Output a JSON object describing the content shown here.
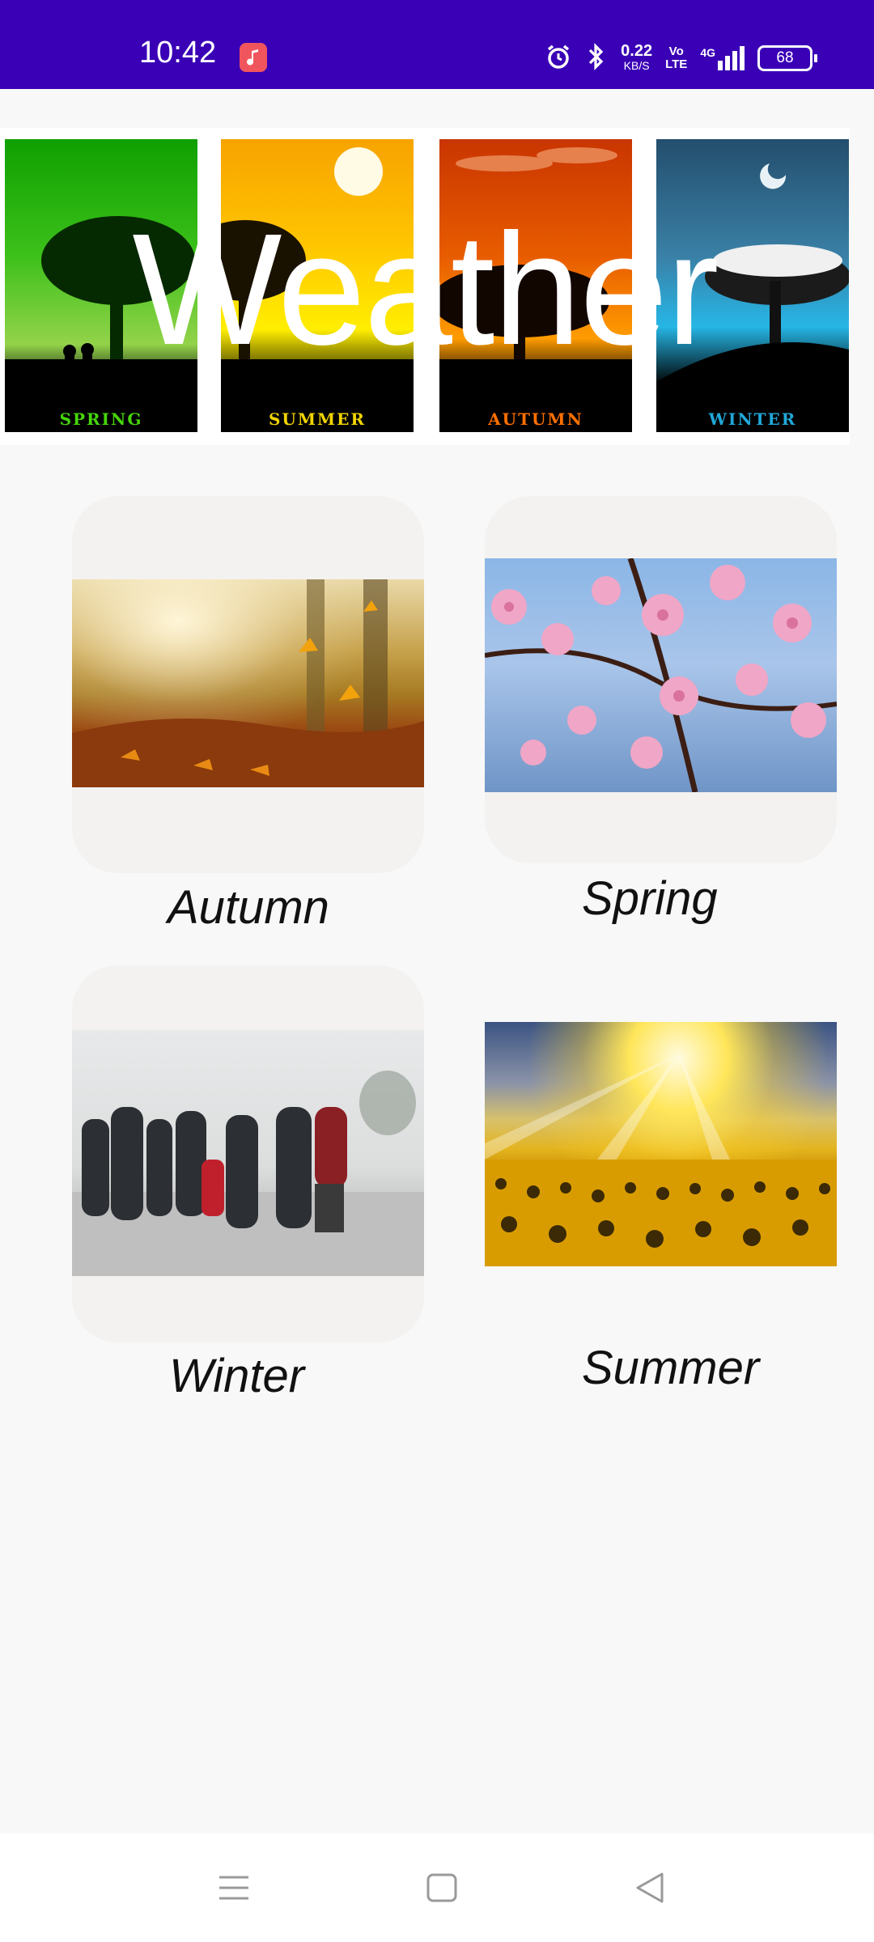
{
  "status_bar": {
    "time": "10:42",
    "net_speed_value": "0.22",
    "net_speed_unit": "KB/S",
    "volte": "Vo\nLTE",
    "network": "4G",
    "battery": "68",
    "color": "#3a00b6"
  },
  "banner": {
    "title": "Weather",
    "panels": [
      {
        "caption": "SPRING",
        "color": "#46d60b"
      },
      {
        "caption": "SUMMER",
        "color": "#f1d400"
      },
      {
        "caption": "AUTUMN",
        "color": "#ff6f00"
      },
      {
        "caption": "WINTER",
        "color": "#20a8d8"
      }
    ]
  },
  "cards": [
    {
      "label": "Autumn",
      "image": "autumn-leaves-photo"
    },
    {
      "label": "Spring",
      "image": "cherry-blossom-photo"
    },
    {
      "label": "Winter",
      "image": "people-walking-in-snow-photo"
    },
    {
      "label": "Summer",
      "image": "sunflower-field-photo"
    }
  ],
  "nav": {
    "icons": [
      "menu-icon",
      "home-icon",
      "back-icon"
    ]
  }
}
